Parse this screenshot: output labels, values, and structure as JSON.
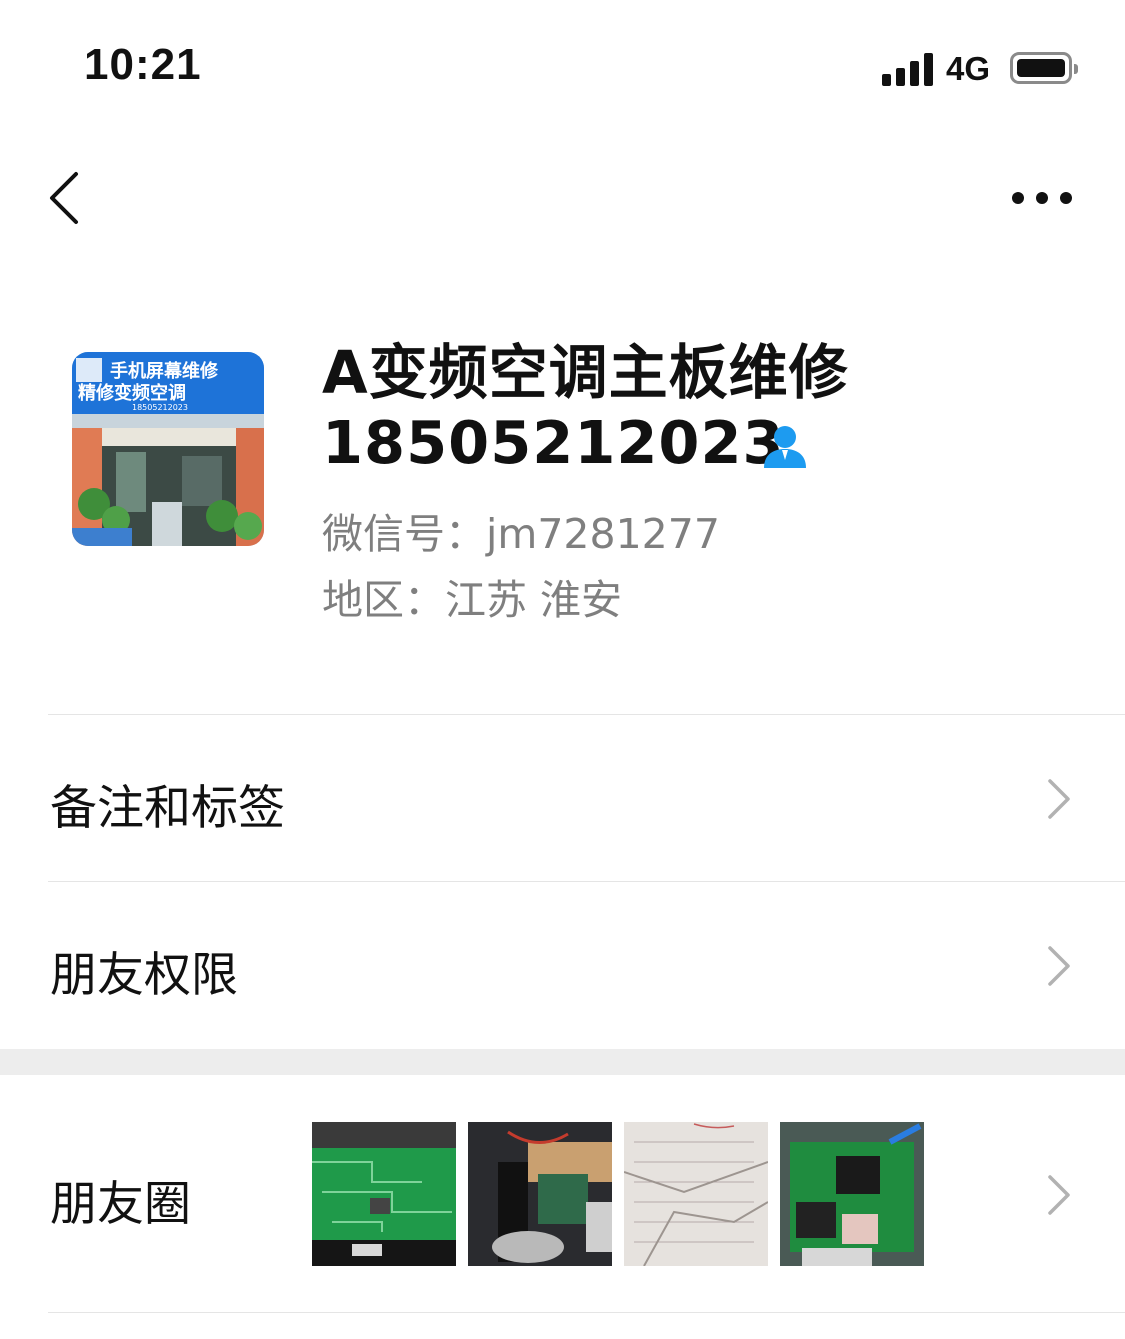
{
  "status_bar": {
    "time": "10:21",
    "network": "4G"
  },
  "nav": {
    "back_icon": "chevron-left-icon",
    "more_icon": "ellipsis-icon"
  },
  "profile": {
    "avatar_sign": {
      "line1": "手机屏幕维修",
      "line2": "精修变频空调",
      "phone": "18505212023"
    },
    "name": "A变频空调主板维修18505212023",
    "contact_icon": "contact-person-icon",
    "wechat_id": "微信号：jm7281277",
    "region": "地区：江苏 淮安"
  },
  "rows": [
    {
      "label": "备注和标签"
    },
    {
      "label": "朋友权限"
    },
    {
      "label": "朋友圈"
    }
  ],
  "moments": {
    "thumbnails": [
      "circuit-board-photo",
      "appliance-repair-photo",
      "paper-note-photo",
      "power-module-board-photo"
    ]
  },
  "colors": {
    "accent_blue": "#1d9bf0",
    "secondary_text": "#7f7f7f",
    "divider": "#e5e5e5"
  }
}
